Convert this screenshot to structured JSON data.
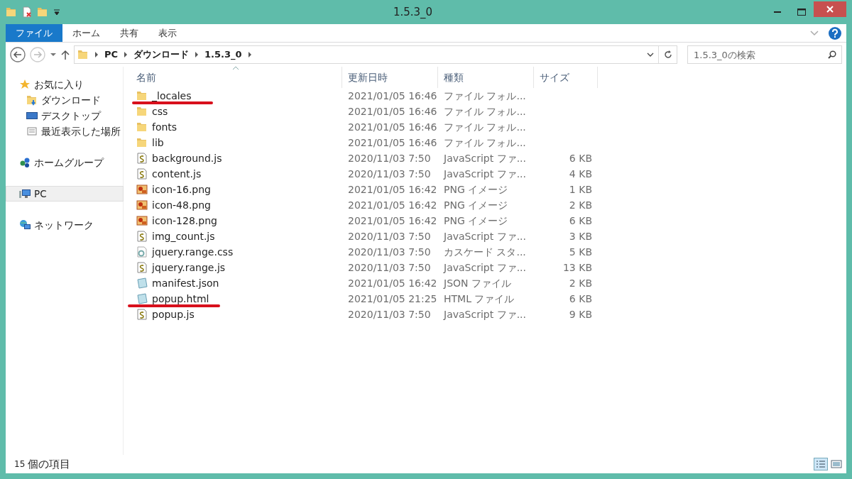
{
  "window": {
    "title": "1.5.3_0"
  },
  "ribbon_tabs": [
    {
      "label": "ファイル",
      "selected": true
    },
    {
      "label": "ホーム",
      "selected": false
    },
    {
      "label": "共有",
      "selected": false
    },
    {
      "label": "表示",
      "selected": false
    }
  ],
  "address_bar": {
    "crumbs": [
      "PC",
      "ダウンロード",
      "1.5.3_0"
    ]
  },
  "search": {
    "placeholder": "1.5.3_0の検索"
  },
  "sidebar": {
    "groups": [
      {
        "label": "お気に入り",
        "kind": "star",
        "selected": false,
        "children": [
          {
            "label": "ダウンロード",
            "kind": "downloads",
            "selected": false
          },
          {
            "label": "デスクトップ",
            "kind": "desktop",
            "selected": false
          },
          {
            "label": "最近表示した場所",
            "kind": "recent",
            "selected": false
          }
        ]
      },
      {
        "label": "ホームグループ",
        "kind": "homegroup",
        "selected": false
      },
      {
        "label": "PC",
        "kind": "pc",
        "selected": true
      },
      {
        "label": "ネットワーク",
        "kind": "network",
        "selected": false
      }
    ]
  },
  "table": {
    "columns": [
      "名前",
      "更新日時",
      "種類",
      "サイズ"
    ],
    "rows": [
      {
        "name": "_locales",
        "date": "2021/01/05 16:46",
        "type": "ファイル フォル...",
        "size": "",
        "kind": "folder",
        "marked": true
      },
      {
        "name": "css",
        "date": "2021/01/05 16:46",
        "type": "ファイル フォル...",
        "size": "",
        "kind": "folder",
        "marked": false
      },
      {
        "name": "fonts",
        "date": "2021/01/05 16:46",
        "type": "ファイル フォル...",
        "size": "",
        "kind": "folder",
        "marked": false
      },
      {
        "name": "lib",
        "date": "2021/01/05 16:46",
        "type": "ファイル フォル...",
        "size": "",
        "kind": "folder",
        "marked": false
      },
      {
        "name": "background.js",
        "date": "2020/11/03 7:50",
        "type": "JavaScript ファ...",
        "size": "6 KB",
        "kind": "script",
        "marked": false
      },
      {
        "name": "content.js",
        "date": "2020/11/03 7:50",
        "type": "JavaScript ファ...",
        "size": "4 KB",
        "kind": "script",
        "marked": false
      },
      {
        "name": "icon-16.png",
        "date": "2021/01/05 16:42",
        "type": "PNG イメージ",
        "size": "1 KB",
        "kind": "image",
        "marked": false
      },
      {
        "name": "icon-48.png",
        "date": "2021/01/05 16:42",
        "type": "PNG イメージ",
        "size": "2 KB",
        "kind": "image",
        "marked": false
      },
      {
        "name": "icon-128.png",
        "date": "2021/01/05 16:42",
        "type": "PNG イメージ",
        "size": "6 KB",
        "kind": "image",
        "marked": false
      },
      {
        "name": "img_count.js",
        "date": "2020/11/03 7:50",
        "type": "JavaScript ファ...",
        "size": "3 KB",
        "kind": "script",
        "marked": false
      },
      {
        "name": "jquery.range.css",
        "date": "2020/11/03 7:50",
        "type": "カスケード スタ...",
        "size": "5 KB",
        "kind": "stylesheet",
        "marked": false
      },
      {
        "name": "jquery.range.js",
        "date": "2020/11/03 7:50",
        "type": "JavaScript ファ...",
        "size": "13 KB",
        "kind": "script",
        "marked": false
      },
      {
        "name": "manifest.json",
        "date": "2021/01/05 16:42",
        "type": "JSON ファイル",
        "size": "2 KB",
        "kind": "document",
        "marked": false
      },
      {
        "name": "popup.html",
        "date": "2021/01/05 21:25",
        "type": "HTML ファイル",
        "size": "6 KB",
        "kind": "document",
        "marked": true
      },
      {
        "name": "popup.js",
        "date": "2020/11/03 7:50",
        "type": "JavaScript ファ...",
        "size": "9 KB",
        "kind": "script",
        "marked": false
      }
    ]
  },
  "status_bar": {
    "count": "15",
    "label": "個の項目"
  }
}
